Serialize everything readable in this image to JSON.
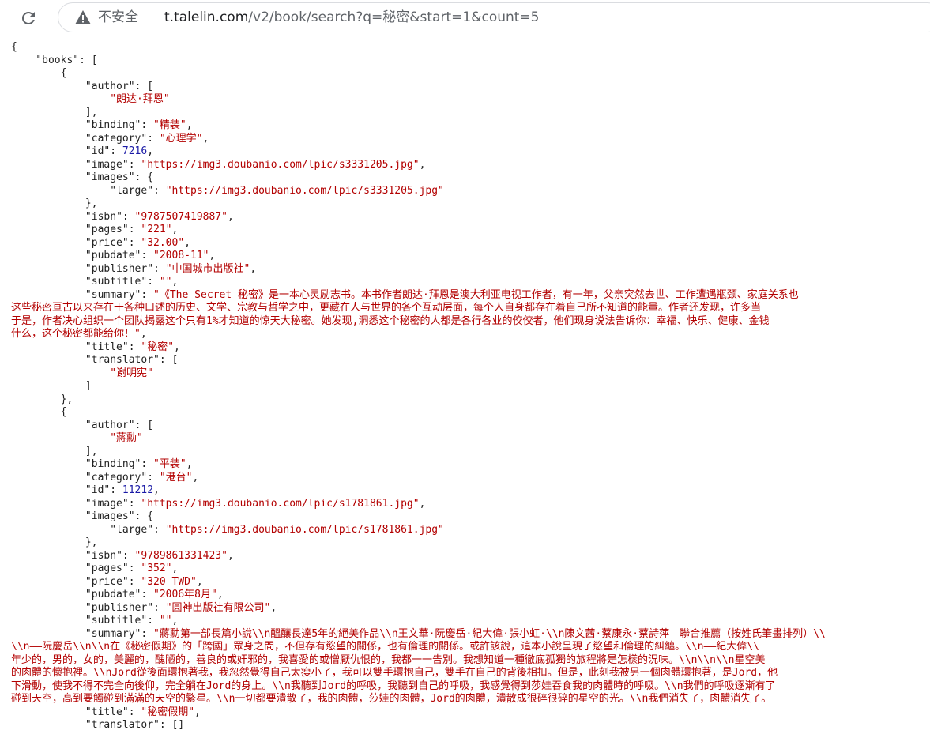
{
  "browser": {
    "insecure_label": "不安全",
    "url_host": "t.talelin.com",
    "url_path": "/v2/book/search?q=秘密&start=1&count=5"
  },
  "json_lines": [
    [
      {
        "t": "p",
        "v": "{"
      }
    ],
    [
      {
        "t": "p",
        "v": "    \""
      },
      {
        "t": "k",
        "v": "books"
      },
      {
        "t": "p",
        "v": "\": ["
      }
    ],
    [
      {
        "t": "p",
        "v": "        {"
      }
    ],
    [
      {
        "t": "p",
        "v": "            \""
      },
      {
        "t": "k",
        "v": "author"
      },
      {
        "t": "p",
        "v": "\": ["
      }
    ],
    [
      {
        "t": "p",
        "v": "                "
      },
      {
        "t": "s",
        "v": "\"朗达·拜恩\""
      }
    ],
    [
      {
        "t": "p",
        "v": "            ],"
      }
    ],
    [
      {
        "t": "p",
        "v": "            \""
      },
      {
        "t": "k",
        "v": "binding"
      },
      {
        "t": "p",
        "v": "\": "
      },
      {
        "t": "s",
        "v": "\"精装\""
      },
      {
        "t": "p",
        "v": ","
      }
    ],
    [
      {
        "t": "p",
        "v": "            \""
      },
      {
        "t": "k",
        "v": "category"
      },
      {
        "t": "p",
        "v": "\": "
      },
      {
        "t": "s",
        "v": "\"心理学\""
      },
      {
        "t": "p",
        "v": ","
      }
    ],
    [
      {
        "t": "p",
        "v": "            \""
      },
      {
        "t": "k",
        "v": "id"
      },
      {
        "t": "p",
        "v": "\": "
      },
      {
        "t": "n",
        "v": "7216"
      },
      {
        "t": "p",
        "v": ","
      }
    ],
    [
      {
        "t": "p",
        "v": "            \""
      },
      {
        "t": "k",
        "v": "image"
      },
      {
        "t": "p",
        "v": "\": "
      },
      {
        "t": "s",
        "v": "\"https://img3.doubanio.com/lpic/s3331205.jpg\""
      },
      {
        "t": "p",
        "v": ","
      }
    ],
    [
      {
        "t": "p",
        "v": "            \""
      },
      {
        "t": "k",
        "v": "images"
      },
      {
        "t": "p",
        "v": "\": {"
      }
    ],
    [
      {
        "t": "p",
        "v": "                \""
      },
      {
        "t": "k",
        "v": "large"
      },
      {
        "t": "p",
        "v": "\": "
      },
      {
        "t": "s",
        "v": "\"https://img3.doubanio.com/lpic/s3331205.jpg\""
      }
    ],
    [
      {
        "t": "p",
        "v": "            },"
      }
    ],
    [
      {
        "t": "p",
        "v": "            \""
      },
      {
        "t": "k",
        "v": "isbn"
      },
      {
        "t": "p",
        "v": "\": "
      },
      {
        "t": "s",
        "v": "\"9787507419887\""
      },
      {
        "t": "p",
        "v": ","
      }
    ],
    [
      {
        "t": "p",
        "v": "            \""
      },
      {
        "t": "k",
        "v": "pages"
      },
      {
        "t": "p",
        "v": "\": "
      },
      {
        "t": "s",
        "v": "\"221\""
      },
      {
        "t": "p",
        "v": ","
      }
    ],
    [
      {
        "t": "p",
        "v": "            \""
      },
      {
        "t": "k",
        "v": "price"
      },
      {
        "t": "p",
        "v": "\": "
      },
      {
        "t": "s",
        "v": "\"32.00\""
      },
      {
        "t": "p",
        "v": ","
      }
    ],
    [
      {
        "t": "p",
        "v": "            \""
      },
      {
        "t": "k",
        "v": "pubdate"
      },
      {
        "t": "p",
        "v": "\": "
      },
      {
        "t": "s",
        "v": "\"2008-11\""
      },
      {
        "t": "p",
        "v": ","
      }
    ],
    [
      {
        "t": "p",
        "v": "            \""
      },
      {
        "t": "k",
        "v": "publisher"
      },
      {
        "t": "p",
        "v": "\": "
      },
      {
        "t": "s",
        "v": "\"中国城市出版社\""
      },
      {
        "t": "p",
        "v": ","
      }
    ],
    [
      {
        "t": "p",
        "v": "            \""
      },
      {
        "t": "k",
        "v": "subtitle"
      },
      {
        "t": "p",
        "v": "\": "
      },
      {
        "t": "s",
        "v": "\"\""
      },
      {
        "t": "p",
        "v": ","
      }
    ],
    [
      {
        "t": "p",
        "v": "            \""
      },
      {
        "t": "k",
        "v": "summary"
      },
      {
        "t": "p",
        "v": "\": "
      },
      {
        "t": "s",
        "v": "\"《The Secret 秘密》是一本心灵励志书。本书作者朗达·拜恩是澳大利亚电视工作者，有一年，父亲突然去世、工作遭遇瓶颈、家庭关系也"
      }
    ],
    [
      {
        "t": "s",
        "v": "这些秘密亘古以来存在于各种口述的历史、文学、宗教与哲学之中，更藏在人与世界的各个互动层面，每个人自身都存在着自己所不知道的能量。作者还发现，许多当"
      }
    ],
    [
      {
        "t": "s",
        "v": "于是，作者决心组织一个团队揭露这个只有1%才知道的惊天大秘密。她发现,洞悉这个秘密的人都是各行各业的佼佼者，他们现身说法告诉你：幸福、快乐、健康、金钱"
      }
    ],
    [
      {
        "t": "s",
        "v": "什么，这个秘密都能给你！\""
      },
      {
        "t": "p",
        "v": ","
      }
    ],
    [
      {
        "t": "p",
        "v": "            \""
      },
      {
        "t": "k",
        "v": "title"
      },
      {
        "t": "p",
        "v": "\": "
      },
      {
        "t": "s",
        "v": "\"秘密\""
      },
      {
        "t": "p",
        "v": ","
      }
    ],
    [
      {
        "t": "p",
        "v": "            \""
      },
      {
        "t": "k",
        "v": "translator"
      },
      {
        "t": "p",
        "v": "\": ["
      }
    ],
    [
      {
        "t": "p",
        "v": "                "
      },
      {
        "t": "s",
        "v": "\"谢明宪\""
      }
    ],
    [
      {
        "t": "p",
        "v": "            ]"
      }
    ],
    [
      {
        "t": "p",
        "v": "        },"
      }
    ],
    [
      {
        "t": "p",
        "v": "        {"
      }
    ],
    [
      {
        "t": "p",
        "v": "            \""
      },
      {
        "t": "k",
        "v": "author"
      },
      {
        "t": "p",
        "v": "\": ["
      }
    ],
    [
      {
        "t": "p",
        "v": "                "
      },
      {
        "t": "s",
        "v": "\"蔣勳\""
      }
    ],
    [
      {
        "t": "p",
        "v": "            ],"
      }
    ],
    [
      {
        "t": "p",
        "v": "            \""
      },
      {
        "t": "k",
        "v": "binding"
      },
      {
        "t": "p",
        "v": "\": "
      },
      {
        "t": "s",
        "v": "\"平装\""
      },
      {
        "t": "p",
        "v": ","
      }
    ],
    [
      {
        "t": "p",
        "v": "            \""
      },
      {
        "t": "k",
        "v": "category"
      },
      {
        "t": "p",
        "v": "\": "
      },
      {
        "t": "s",
        "v": "\"港台\""
      },
      {
        "t": "p",
        "v": ","
      }
    ],
    [
      {
        "t": "p",
        "v": "            \""
      },
      {
        "t": "k",
        "v": "id"
      },
      {
        "t": "p",
        "v": "\": "
      },
      {
        "t": "n",
        "v": "11212"
      },
      {
        "t": "p",
        "v": ","
      }
    ],
    [
      {
        "t": "p",
        "v": "            \""
      },
      {
        "t": "k",
        "v": "image"
      },
      {
        "t": "p",
        "v": "\": "
      },
      {
        "t": "s",
        "v": "\"https://img3.doubanio.com/lpic/s1781861.jpg\""
      },
      {
        "t": "p",
        "v": ","
      }
    ],
    [
      {
        "t": "p",
        "v": "            \""
      },
      {
        "t": "k",
        "v": "images"
      },
      {
        "t": "p",
        "v": "\": {"
      }
    ],
    [
      {
        "t": "p",
        "v": "                \""
      },
      {
        "t": "k",
        "v": "large"
      },
      {
        "t": "p",
        "v": "\": "
      },
      {
        "t": "s",
        "v": "\"https://img3.doubanio.com/lpic/s1781861.jpg\""
      }
    ],
    [
      {
        "t": "p",
        "v": "            },"
      }
    ],
    [
      {
        "t": "p",
        "v": "            \""
      },
      {
        "t": "k",
        "v": "isbn"
      },
      {
        "t": "p",
        "v": "\": "
      },
      {
        "t": "s",
        "v": "\"9789861331423\""
      },
      {
        "t": "p",
        "v": ","
      }
    ],
    [
      {
        "t": "p",
        "v": "            \""
      },
      {
        "t": "k",
        "v": "pages"
      },
      {
        "t": "p",
        "v": "\": "
      },
      {
        "t": "s",
        "v": "\"352\""
      },
      {
        "t": "p",
        "v": ","
      }
    ],
    [
      {
        "t": "p",
        "v": "            \""
      },
      {
        "t": "k",
        "v": "price"
      },
      {
        "t": "p",
        "v": "\": "
      },
      {
        "t": "s",
        "v": "\"320 TWD\""
      },
      {
        "t": "p",
        "v": ","
      }
    ],
    [
      {
        "t": "p",
        "v": "            \""
      },
      {
        "t": "k",
        "v": "pubdate"
      },
      {
        "t": "p",
        "v": "\": "
      },
      {
        "t": "s",
        "v": "\"2006年8月\""
      },
      {
        "t": "p",
        "v": ","
      }
    ],
    [
      {
        "t": "p",
        "v": "            \""
      },
      {
        "t": "k",
        "v": "publisher"
      },
      {
        "t": "p",
        "v": "\": "
      },
      {
        "t": "s",
        "v": "\"圓神出版社有限公司\""
      },
      {
        "t": "p",
        "v": ","
      }
    ],
    [
      {
        "t": "p",
        "v": "            \""
      },
      {
        "t": "k",
        "v": "subtitle"
      },
      {
        "t": "p",
        "v": "\": "
      },
      {
        "t": "s",
        "v": "\"\""
      },
      {
        "t": "p",
        "v": ","
      }
    ],
    [
      {
        "t": "p",
        "v": "            \""
      },
      {
        "t": "k",
        "v": "summary"
      },
      {
        "t": "p",
        "v": "\": "
      },
      {
        "t": "s",
        "v": "\"蔣勳第一部長篇小說\\\\n醞釀長達5年的絕美作品\\\\n王文華·阮慶岳·紀大偉·張小虹·\\\\n陳文茜·蔡康永·蔡詩萍　聯合推薦（按姓氏筆畫排列）\\\\"
      }
    ],
    [
      {
        "t": "s",
        "v": "\\\\n——阮慶岳\\\\n\\\\n在《秘密假期》的「跨國」眾身之間，不但存有慾望的關係，也有倫理的關係。或許該說，這本小說呈現了慾望和倫理的糾纏。\\\\n——紀大偉\\\\"
      }
    ],
    [
      {
        "t": "s",
        "v": "年少的，男的，女的，美麗的，醜陋的，善良的或奸邪的，我喜愛的或憎厭仇恨的，我都一一告別。我想知道一種徹底孤獨的旅程將是怎樣的況味。\\\\n\\\\n\\\\n星空美"
      }
    ],
    [
      {
        "t": "s",
        "v": "的肉體的懷抱裡。\\\\nJord從後面環抱著我，我忽然覺得自己太瘦小了，我可以雙手環抱自己，雙手在自己的背後相扣。但是，此刻我被另一個肉體環抱著，是Jord，他"
      }
    ],
    [
      {
        "t": "s",
        "v": "下滑動，使我不得不完全向後仰，完全躺在Jord的身上。\\\\n我聽到Jord的呼吸，我聽到自己的呼吸，我感覺得到莎娃吞食我的肉體時的呼吸。\\\\n我們的呼吸逐漸有了"
      }
    ],
    [
      {
        "t": "s",
        "v": "碰到天空，高到要觸碰到滿滿的天空的繁星。\\\\n一切都要潰散了，我的肉體，莎娃的肉體，Jord的肉體，潰散成很碎很碎的星空的光。\\\\n我們消失了，肉體消失了。"
      }
    ],
    [
      {
        "t": "p",
        "v": "            \""
      },
      {
        "t": "k",
        "v": "title"
      },
      {
        "t": "p",
        "v": "\": "
      },
      {
        "t": "s",
        "v": "\"秘密假期\""
      },
      {
        "t": "p",
        "v": ","
      }
    ],
    [
      {
        "t": "p",
        "v": "            \""
      },
      {
        "t": "k",
        "v": "translator"
      },
      {
        "t": "p",
        "v": "\": []"
      }
    ]
  ]
}
